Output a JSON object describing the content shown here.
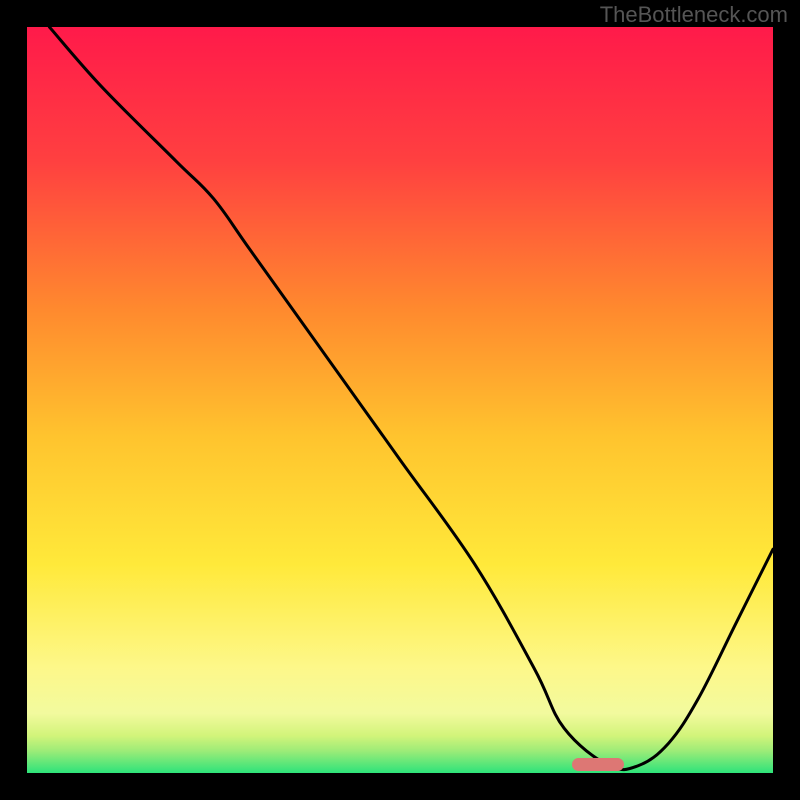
{
  "watermark": "TheBottleneck.com",
  "chart_data": {
    "type": "line",
    "title": "",
    "xlabel": "",
    "ylabel": "",
    "xlim": [
      0,
      100
    ],
    "ylim": [
      0,
      100
    ],
    "grid": false,
    "legend": false,
    "background_gradient": {
      "top": "#ff1a4a",
      "mid_upper": "#ff7a33",
      "mid": "#ffcf2e",
      "mid_lower": "#fff88a",
      "bottom": "#2ee37a"
    },
    "series": [
      {
        "name": "bottleneck-curve",
        "color": "#000000",
        "x": [
          3,
          10,
          20,
          25,
          30,
          40,
          50,
          60,
          68,
          72,
          78,
          82,
          86,
          90,
          95,
          100
        ],
        "values": [
          100,
          92,
          82,
          77,
          70,
          56,
          42,
          28,
          14,
          6,
          1,
          1,
          4,
          10,
          20,
          30
        ]
      }
    ],
    "marker": {
      "name": "optimal-range",
      "color": "#dd7774",
      "x_start": 73,
      "x_end": 80,
      "y": 1.2
    }
  }
}
